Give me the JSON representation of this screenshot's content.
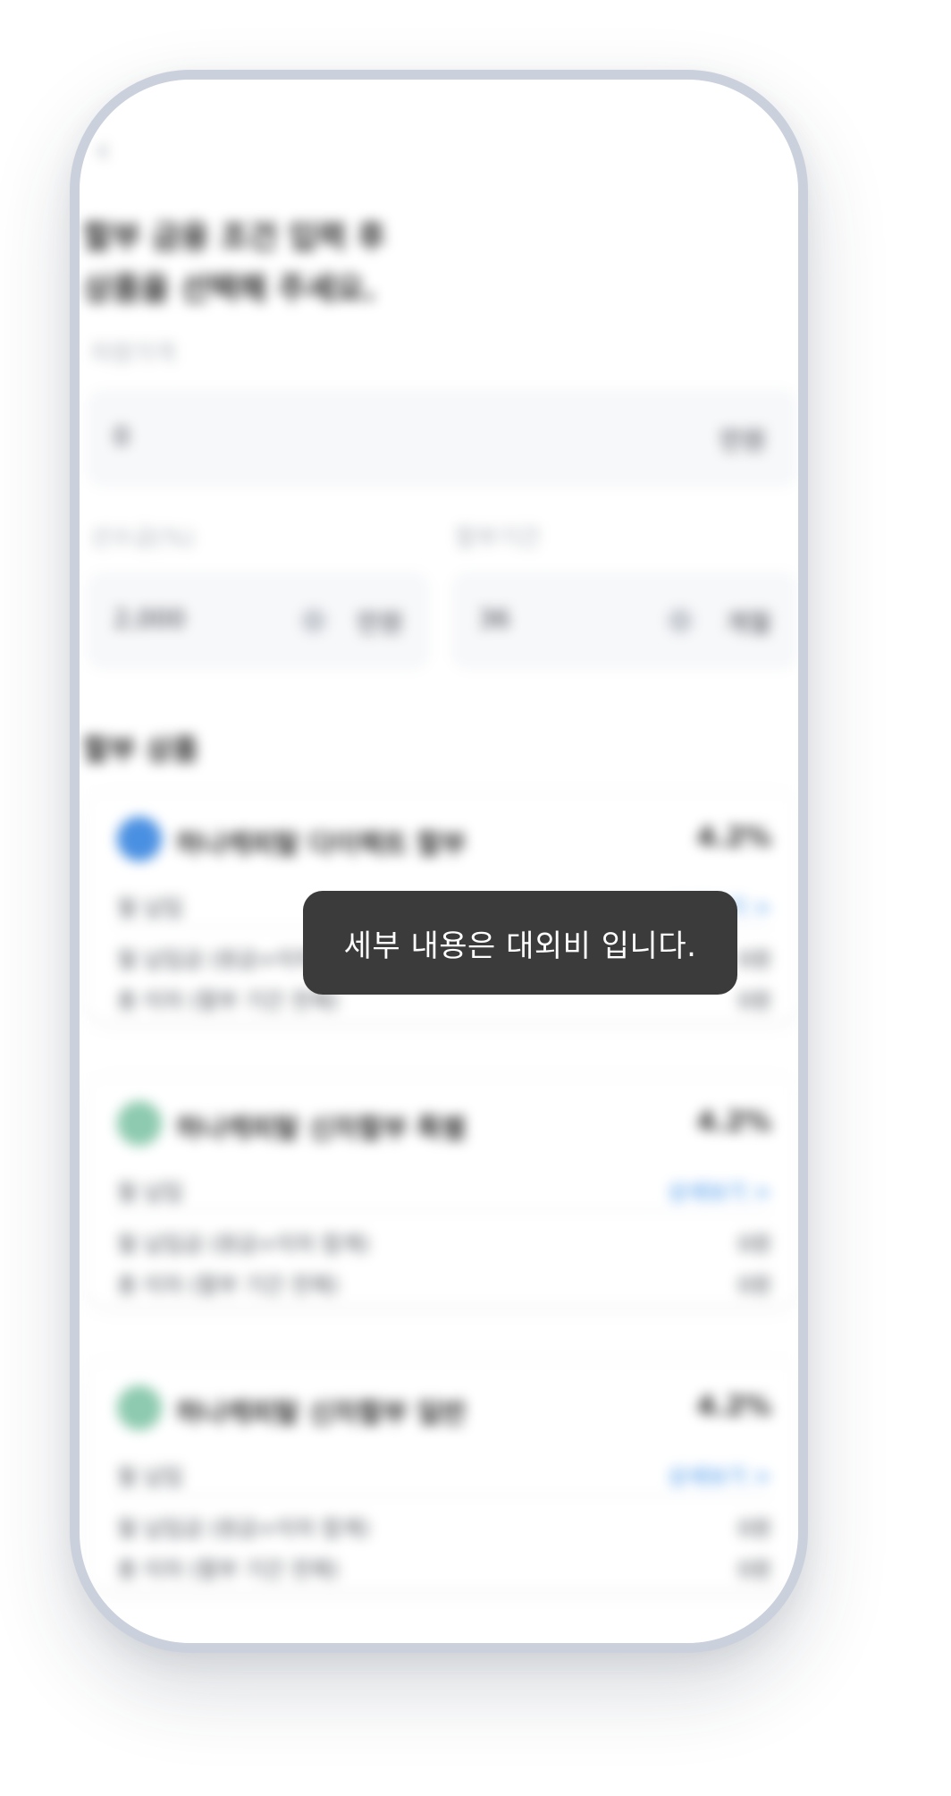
{
  "toast": {
    "message": "세부 내용은 대외비 입니다."
  },
  "screen": {
    "back_label": "‹",
    "headline_line1": "할부 금융 조건 입력 후",
    "headline_line2": "상품을 선택해 주세요.",
    "price_label": "차량가격",
    "price_value": "0",
    "price_unit": "만원",
    "down_label": "선수금(%)",
    "down_value": "2,000",
    "down_unit": "만원",
    "term_label": "할부기간",
    "term_value": "36",
    "term_unit": "개월",
    "section_title": "할부 상품",
    "products": [
      {
        "logo_color": "#4a90e2",
        "name": "하나캐피탈 다이렉트 할부",
        "rate": "4.2%",
        "sub_left": "월 납입",
        "sub_right": "상세보기 >",
        "row1_left": "월 납입금 (원금+이자 합계)",
        "row1_right": "0원",
        "row2_left": "총 이자 (할부 기간 전체)",
        "row2_right": "0원"
      },
      {
        "logo_color": "#2f9e6e",
        "name": "하나캐피탈 신차할부 특별",
        "rate": "4.2%",
        "sub_left": "월 납입",
        "sub_right": "상세보기 >",
        "row1_left": "월 납입금 (원금+이자 합계)",
        "row1_right": "0원",
        "row2_left": "총 이자 (할부 기간 전체)",
        "row2_right": "0원"
      },
      {
        "logo_color": "#2f9e6e",
        "name": "하나캐피탈 신차할부 일반",
        "rate": "4.2%",
        "sub_left": "월 납입",
        "sub_right": "상세보기 >",
        "row1_left": "월 납입금 (원금+이자 합계)",
        "row1_right": "0원",
        "row2_left": "총 이자 (할부 기간 전체)",
        "row2_right": "0원"
      }
    ]
  }
}
